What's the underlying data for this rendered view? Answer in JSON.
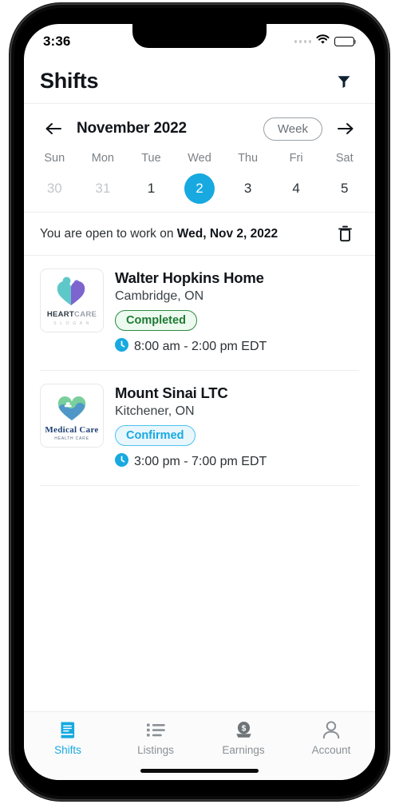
{
  "status_bar": {
    "time": "3:36",
    "signal_icon": "signal-dots-icon",
    "wifi_icon": "wifi-icon",
    "battery_icon": "battery-full-icon"
  },
  "header": {
    "title": "Shifts",
    "filter_icon": "filter-funnel-icon"
  },
  "calendar": {
    "prev_icon": "arrow-left-icon",
    "next_icon": "arrow-right-icon",
    "month_label": "November 2022",
    "range_mode": "Week",
    "weekdays": [
      "Sun",
      "Mon",
      "Tue",
      "Wed",
      "Thu",
      "Fri",
      "Sat"
    ],
    "days": [
      {
        "number": "30",
        "state": "muted"
      },
      {
        "number": "31",
        "state": "muted"
      },
      {
        "number": "1",
        "state": "normal"
      },
      {
        "number": "2",
        "state": "selected"
      },
      {
        "number": "3",
        "state": "normal"
      },
      {
        "number": "4",
        "state": "normal"
      },
      {
        "number": "5",
        "state": "normal"
      }
    ],
    "selected_color": "#17a9e0"
  },
  "availability": {
    "prefix": "You are open to work on ",
    "date": "Wed, Nov 2, 2022",
    "delete_icon": "trash-icon"
  },
  "shifts": [
    {
      "name": "Walter Hopkins Home",
      "location": "Cambridge, ON",
      "status": "Completed",
      "status_type": "completed",
      "status_color": "#2e8b43",
      "time": "8:00 am - 2:00 pm EDT",
      "clock_icon": "clock-icon",
      "logo": {
        "icon": "heartcare-logo-icon",
        "word_a": "HEART",
        "word_b": "CARE",
        "slogan": "S L O G A N"
      }
    },
    {
      "name": "Mount Sinai LTC",
      "location": "Kitchener, ON",
      "status": "Confirmed",
      "status_type": "confirmed",
      "status_color": "#17a9e0",
      "time": "3:00 pm - 7:00 pm EDT",
      "clock_icon": "clock-icon",
      "logo": {
        "icon": "medicalcare-logo-icon",
        "word_a": "Medical Care",
        "slogan": "HEALTH CARE"
      }
    }
  ],
  "tab_bar": {
    "items": [
      {
        "label": "Shifts",
        "icon": "book-icon",
        "active": true
      },
      {
        "label": "Listings",
        "icon": "list-icon",
        "active": false
      },
      {
        "label": "Earnings",
        "icon": "dollar-coin-icon",
        "active": false
      },
      {
        "label": "Account",
        "icon": "person-icon",
        "active": false
      }
    ],
    "active_color": "#17a9e0",
    "inactive_color": "#8a9095"
  }
}
